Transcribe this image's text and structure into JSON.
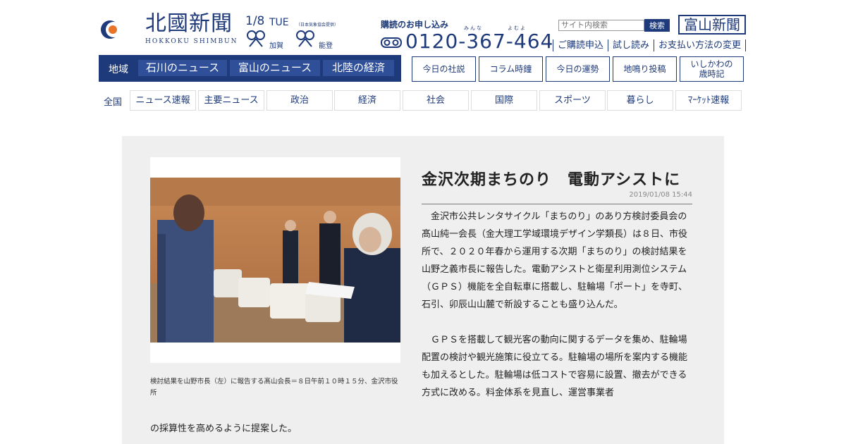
{
  "header": {
    "logo": {
      "title": "北國新聞",
      "subtitle": "HOKKOKU SHIMBUN"
    },
    "date": "1/8",
    "weekday": "TUE",
    "weather_credit": "（日本気象協会提供）",
    "weather": [
      {
        "area": "加賀",
        "icon": "weather-icon"
      },
      {
        "area": "能登",
        "icon": "weather-icon"
      }
    ],
    "subscription": {
      "title": "購読のお申し込み",
      "ruby1": "みんな",
      "ruby2": "よむよ",
      "phone": "0120-367-464"
    },
    "search": {
      "placeholder": "サイト内検索",
      "button": "検索"
    },
    "toyama_link": "富山新聞",
    "sub_links": [
      "ご購読申込",
      "試し読み",
      "お支払い方法の変更"
    ]
  },
  "region_nav": {
    "label": "地域",
    "tabs": [
      "石川のニュース",
      "富山のニュース",
      "北陸の経済"
    ]
  },
  "column_links": [
    "今日の社説",
    "コラム時鐘",
    "今日の運勢",
    "地鳴り投稿",
    "いしかわの\n歳時記"
  ],
  "category_nav": {
    "label": "全国",
    "items": [
      "ニュース速報",
      "主要ニュース",
      "政治",
      "経済",
      "社会",
      "国際",
      "スポーツ",
      "暮らし",
      "ﾏｰｹｯﾄ速報"
    ]
  },
  "article": {
    "headline": "金沢次期まちのり　電動アシストに",
    "timestamp": "2019/01/08 15:44",
    "caption": "検討結果を山野市長（左）に報告する髙山会長＝８日午前１０時１５分、金沢市役所",
    "paragraphs": [
      "金沢市公共レンタサイクル「まちのり」のあり方検討委員会の髙山純一会長（金大理工学域環境デザイン学類長）は８日、市役所で、２０２０年春から運用する次期「まちのり」の検討結果を山野之義市長に報告した。電動アシストと衛星利用測位システム（ＧＰＳ）機能を全自転車に搭載し、駐輪場「ポート」を寺町、石引、卯辰山山麓で新設することも盛り込んだ。",
      "ＧＰＳを搭載して観光客の動向に関するデータを集め、駐輪場配置の検討や観光施策に役立てる。駐輪場の場所を案内する機能も加えるとした。駐輪場は低コストで容易に設置、撤去ができる方式に改める。料金体系を見直し、運営事業者"
    ],
    "tail_text": "の採算性を高めるように提案した。"
  },
  "colors": {
    "brand": "#1e3a7a",
    "region_tab": "#2f4f99",
    "article_bg": "#efefef",
    "logo_orange": "#e8742a"
  }
}
